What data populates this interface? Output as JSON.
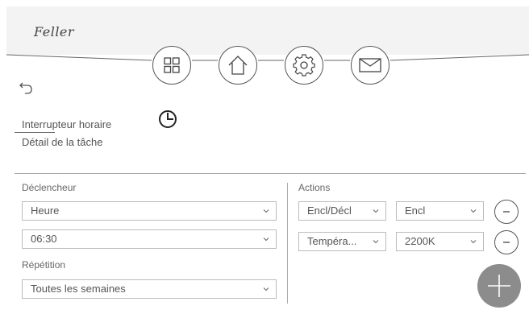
{
  "header": {
    "logo_text": "Feller"
  },
  "nav": {
    "icons": [
      "grid-icon",
      "home-icon",
      "gear-icon",
      "mail-icon"
    ]
  },
  "page": {
    "title": "Interrupteur horaire",
    "subtitle": "Détail de la tâche"
  },
  "trigger": {
    "label": "Déclencheur",
    "type_value": "Heure",
    "time_value": "06:30",
    "repeat_label": "Répétition",
    "repeat_value": "Toutes les semaines"
  },
  "actions": {
    "label": "Actions",
    "rows": [
      {
        "action": "Encl/Décl",
        "value": "Encl"
      },
      {
        "action": "Tempéra...",
        "value": "2200K"
      }
    ]
  },
  "colors": {
    "fab": "#8c8c8c",
    "header_bg": "#f3f3f3"
  }
}
